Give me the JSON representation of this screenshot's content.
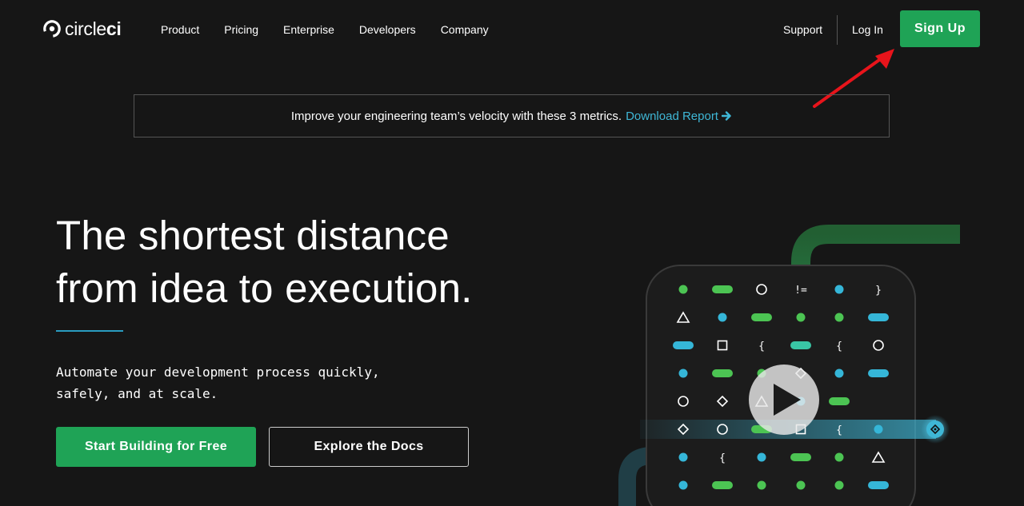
{
  "nav": {
    "logo": {
      "light": "circle",
      "bold": "ci"
    },
    "links": [
      "Product",
      "Pricing",
      "Enterprise",
      "Developers",
      "Company"
    ],
    "support": "Support",
    "login": "Log In",
    "signup": "Sign Up"
  },
  "banner": {
    "text": "Improve your engineering team’s velocity with these 3 metrics.",
    "link": "Download Report"
  },
  "hero": {
    "title_line1": "The shortest distance",
    "title_line2": "from idea to execution.",
    "subtitle_line1": "Automate your development process quickly,",
    "subtitle_line2": "safely, and at scale.",
    "primary_cta": "Start Building for Free",
    "secondary_cta": "Explore the Docs"
  },
  "colors": {
    "background": "#161616",
    "brand_green": "#1fa356",
    "link_blue": "#3fb7d6",
    "annotation_red": "#e8141b"
  },
  "illustration": {
    "grid_symbols": [
      [
        "dot-green",
        "pill-green",
        "circle",
        "!=",
        "dot-blue",
        "}"
      ],
      [
        "triangle",
        "dot-blue",
        "pill-green",
        "dot-green",
        "dot-green",
        "pill-blue"
      ],
      [
        "pill-blue",
        "square",
        "{",
        "pill-teal",
        "{",
        "circle"
      ],
      [
        "dot-blue",
        "pill-green",
        "dot-green",
        "diamond",
        "dot-blue",
        "pill-blue"
      ],
      [
        "circle",
        "diamond",
        "triangle",
        "dot-blue",
        "pill-green",
        ""
      ],
      [
        "diamond",
        "circle",
        "pill-green",
        "square",
        "{",
        "dot-blue"
      ],
      [
        "dot-blue",
        "{",
        "dot-blue",
        "pill-green",
        "dot-green",
        "triangle"
      ],
      [
        "dot-blue",
        "pill-green",
        "dot-green",
        "dot-green",
        "dot-green",
        "pill-blue"
      ]
    ]
  }
}
